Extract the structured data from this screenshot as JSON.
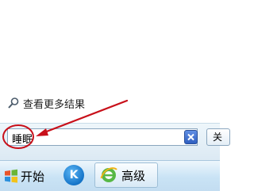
{
  "search_results": {
    "see_more_label": "查看更多结果"
  },
  "search": {
    "query": "睡眠",
    "shutdown_label": "关"
  },
  "taskbar": {
    "start_label": "开始",
    "app_k_letter": "K",
    "advanced_label": "高级"
  },
  "icons": {
    "see_more": "magnifier-icon",
    "clear": "clear-search-icon",
    "start": "windows-logo-icon",
    "app": "k-app-icon",
    "browser": "ie-browser-icon"
  },
  "colors": {
    "annotation": "#c8101a",
    "panel": "#dbe9f3",
    "taskbar": "#c9e3f5"
  }
}
